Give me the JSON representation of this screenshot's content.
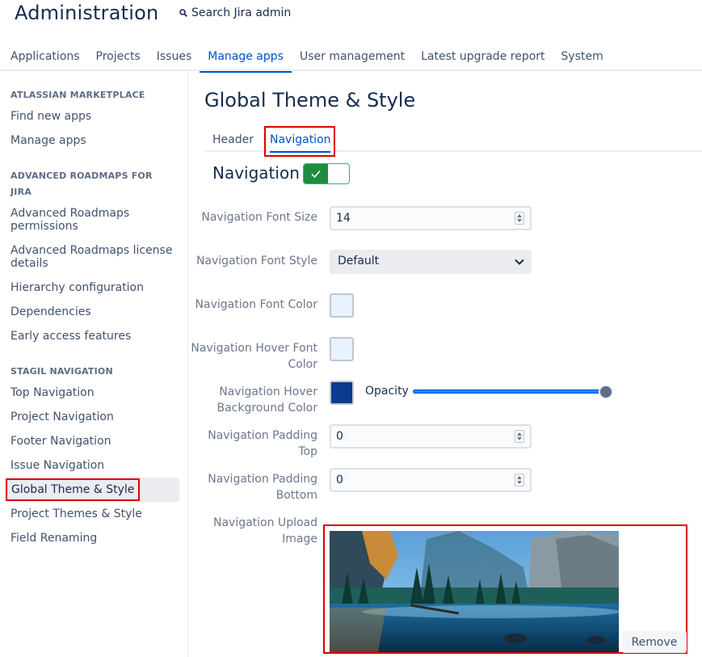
{
  "header": {
    "title": "Administration",
    "search_label": "Search Jira admin"
  },
  "topnav": {
    "tabs": [
      {
        "label": "Applications"
      },
      {
        "label": "Projects"
      },
      {
        "label": "Issues"
      },
      {
        "label": "Manage apps",
        "active": true
      },
      {
        "label": "User management"
      },
      {
        "label": "Latest upgrade report"
      },
      {
        "label": "System"
      }
    ]
  },
  "sidebar": {
    "sections": [
      {
        "heading": "ATLASSIAN MARKETPLACE",
        "items": [
          "Find new apps",
          "Manage apps"
        ]
      },
      {
        "heading": "ADVANCED ROADMAPS FOR JIRA",
        "items": [
          "Advanced Roadmaps permissions",
          "Advanced Roadmaps license details",
          "Hierarchy configuration",
          "Dependencies",
          "Early access features"
        ]
      },
      {
        "heading": "STAGIL NAVIGATION",
        "items": [
          "Top Navigation",
          "Project Navigation",
          "Footer Navigation",
          "Issue Navigation",
          "Global Theme & Style",
          "Project Themes & Style",
          "Field Renaming"
        ]
      }
    ],
    "selected": "Global Theme & Style"
  },
  "main": {
    "title": "Global Theme & Style",
    "subtabs": [
      {
        "label": "Header"
      },
      {
        "label": "Navigation",
        "active": true
      }
    ],
    "section_title": "Navigation",
    "section_enabled": true,
    "fields": {
      "font_size": {
        "label": "Navigation Font Size",
        "value": "14"
      },
      "font_style": {
        "label": "Navigation Font Style",
        "value": "Default"
      },
      "font_color": {
        "label": "Navigation Font Color",
        "color": "#e9f2ff"
      },
      "hover_font_color": {
        "label": "Navigation Hover Font Color",
        "color": "#e9f2ff"
      },
      "hover_bg_color": {
        "label": "Navigation Hover Background Color",
        "color": "#0b3b8c",
        "opacity_label": "Opacity",
        "opacity": 1.0
      },
      "padding_top": {
        "label": "Navigation Padding Top",
        "value": "0"
      },
      "padding_bottom": {
        "label": "Navigation Padding Bottom",
        "value": "0"
      },
      "upload_image": {
        "label": "Navigation Upload Image",
        "remove_label": "Remove"
      }
    }
  },
  "colors": {
    "accent": "#0052cc",
    "highlight": "#dd0000",
    "toggle_on": "#1f8b3f"
  }
}
